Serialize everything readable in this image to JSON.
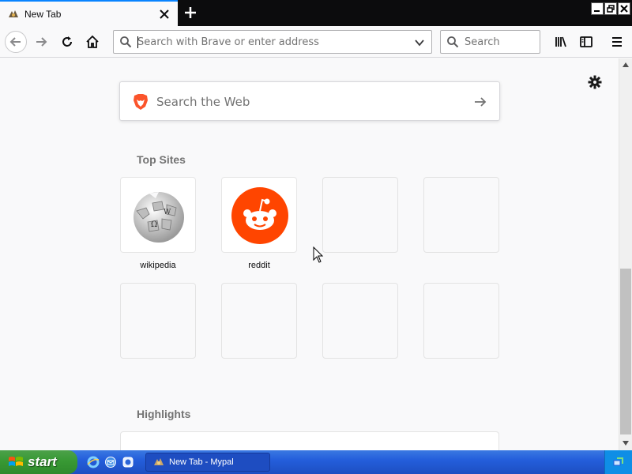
{
  "tab": {
    "title": "New Tab"
  },
  "urlbar": {
    "placeholder": "Search with Brave or enter address"
  },
  "searchbar": {
    "placeholder": "Search"
  },
  "newtab_page": {
    "search_placeholder": "Search the Web",
    "top_sites_title": "Top Sites",
    "top_sites": [
      {
        "label": "wikipedia",
        "icon": "wikipedia-globe-icon"
      },
      {
        "label": "reddit",
        "icon": "reddit-alien-icon"
      }
    ],
    "highlights_title": "Highlights"
  },
  "taskbar": {
    "start_label": "start",
    "task_title": "New Tab - Mypal"
  },
  "colors": {
    "accent": "#0a84ff",
    "reddit": "#ff4500",
    "taskbar": "#245edb",
    "start": "#389934"
  }
}
